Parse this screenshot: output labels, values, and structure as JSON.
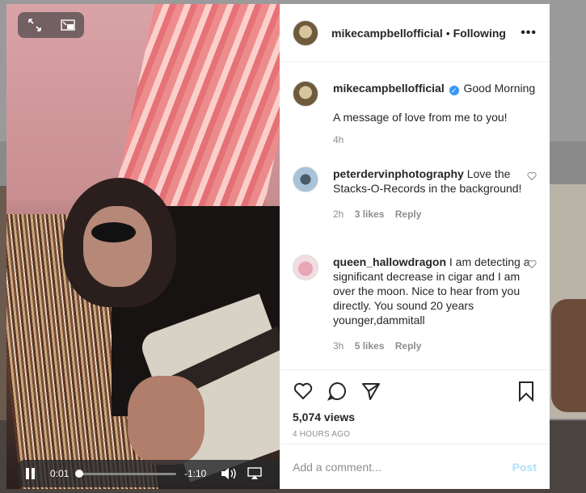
{
  "video": {
    "current_time": "0:01",
    "remaining_time": "-1:10",
    "progress": 0.014
  },
  "header": {
    "username": "mikecampbellofficial",
    "separator": "•",
    "follow_status": "Following",
    "more_label": "•••"
  },
  "caption": {
    "username": "mikecampbellofficial",
    "verified_mark": "✓",
    "text_inline": "Good Morning",
    "text_body": "A message of love from me to you!",
    "time": "4h"
  },
  "comments": [
    {
      "username": "peterdervinphotography",
      "text": "Love the Stacks-O-Records in the background!",
      "time": "2h",
      "likes": "3 likes",
      "reply": "Reply"
    },
    {
      "username": "queen_hallowdragon",
      "text": "I am detecting a significant decrease in cigar and I am over the moon. Nice to hear from you directly. You sound 20 years younger,dammitall",
      "time": "3h",
      "likes": "5 likes",
      "reply": "Reply"
    }
  ],
  "stats": {
    "views": "5,074 views",
    "posted": "4 HOURS AGO"
  },
  "add_comment": {
    "placeholder": "Add a comment...",
    "post_label": "Post"
  },
  "colors": {
    "accent": "#3897f0",
    "post_disabled": "#b2dffc",
    "muted": "#8e8e8e",
    "text": "#262626"
  }
}
